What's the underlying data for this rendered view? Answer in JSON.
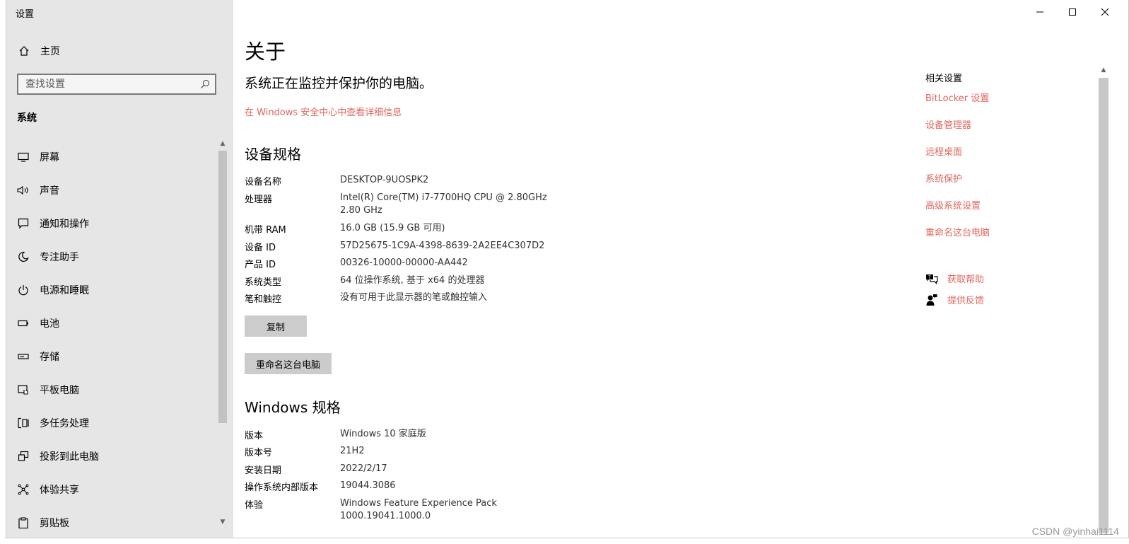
{
  "app": {
    "title": "设置"
  },
  "sidebar": {
    "home_label": "主页",
    "search_placeholder": "查找设置",
    "section_title": "系统",
    "items": [
      {
        "label": "屏幕",
        "icon": "monitor-icon"
      },
      {
        "label": "声音",
        "icon": "speaker-icon"
      },
      {
        "label": "通知和操作",
        "icon": "notification-icon"
      },
      {
        "label": "专注助手",
        "icon": "moon-icon"
      },
      {
        "label": "电源和睡眠",
        "icon": "power-icon"
      },
      {
        "label": "电池",
        "icon": "battery-icon"
      },
      {
        "label": "存储",
        "icon": "storage-icon"
      },
      {
        "label": "平板电脑",
        "icon": "tablet-icon"
      },
      {
        "label": "多任务处理",
        "icon": "multitask-icon"
      },
      {
        "label": "投影到此电脑",
        "icon": "project-icon"
      },
      {
        "label": "体验共享",
        "icon": "share-icon"
      },
      {
        "label": "剪贴板",
        "icon": "clipboard-icon"
      }
    ]
  },
  "main": {
    "title": "关于",
    "protect_text": "系统正在监控并保护你的电脑。",
    "security_link": "在 Windows 安全中心中查看详细信息",
    "device_specs": {
      "heading": "设备规格",
      "rows": [
        {
          "key": "设备名称",
          "value": "DESKTOP-9UOSPK2",
          "value2": ""
        },
        {
          "key": "处理器",
          "value": "Intel(R) Core(TM) i7-7700HQ CPU @ 2.80GHz",
          "value2": "2.80 GHz"
        },
        {
          "key": "机带 RAM",
          "value": "16.0 GB (15.9 GB 可用)",
          "value2": ""
        },
        {
          "key": "设备 ID",
          "value": "57D25675-1C9A-4398-8639-2A2EE4C307D2",
          "value2": ""
        },
        {
          "key": "产品 ID",
          "value": "00326-10000-00000-AA442",
          "value2": ""
        },
        {
          "key": "系统类型",
          "value": "64 位操作系统, 基于 x64 的处理器",
          "value2": ""
        },
        {
          "key": "笔和触控",
          "value": "没有可用于此显示器的笔或触控输入",
          "value2": ""
        }
      ],
      "copy_button": "复制",
      "rename_button": "重命名这台电脑"
    },
    "windows_specs": {
      "heading": "Windows 规格",
      "rows": [
        {
          "key": "版本",
          "value": "Windows 10 家庭版",
          "value2": ""
        },
        {
          "key": "版本号",
          "value": "21H2",
          "value2": ""
        },
        {
          "key": "安装日期",
          "value": "2022/2/17",
          "value2": ""
        },
        {
          "key": "操作系统内部版本",
          "value": "19044.3086",
          "value2": ""
        },
        {
          "key": "体验",
          "value": "Windows Feature Experience Pack",
          "value2": "1000.19041.1000.0"
        }
      ]
    }
  },
  "related": {
    "title": "相关设置",
    "links": [
      "BitLocker 设置",
      "设备管理器",
      "远程桌面",
      "系统保护",
      "高级系统设置",
      "重命名这台电脑"
    ],
    "help_label": "获取帮助",
    "feedback_label": "提供反馈"
  },
  "watermark": "CSDN @yinhai1114",
  "colors": {
    "accent": "#e0645a",
    "sidebar_bg": "#e6e6e6"
  }
}
